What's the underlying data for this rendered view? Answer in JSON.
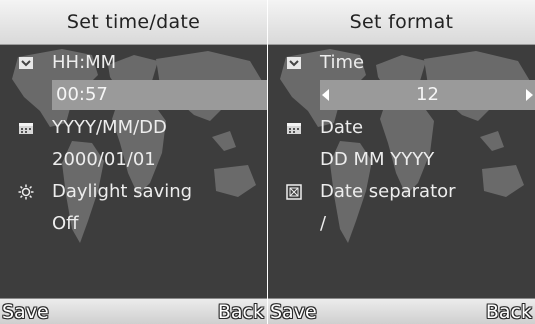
{
  "left_screen": {
    "title": "Set time/date",
    "rows": [
      {
        "label": "HH:MM",
        "icon": "clock-icon"
      },
      {
        "value": "00:57"
      },
      {
        "label": "YYYY/MM/DD",
        "icon": "calendar-icon"
      },
      {
        "value": "2000/01/01"
      },
      {
        "label": "Daylight saving",
        "icon": "sun-icon"
      },
      {
        "value": "Off"
      }
    ],
    "softkeys": {
      "left": "Save",
      "right": "Back"
    }
  },
  "right_screen": {
    "title": "Set format",
    "rows": [
      {
        "label": "Time",
        "icon": "clock-icon"
      },
      {
        "value": "12"
      },
      {
        "label": "Date",
        "icon": "calendar-icon"
      },
      {
        "value": "DD MM YYYY"
      },
      {
        "label": "Date separator",
        "icon": "separator-icon"
      },
      {
        "value": "/"
      }
    ],
    "softkeys": {
      "left": "Save",
      "right": "Back"
    }
  },
  "colors": {
    "background": "#3d3d3d",
    "highlight": "#9a9a9a",
    "text": "#ededed",
    "titlebar": "#e6e6e6"
  }
}
